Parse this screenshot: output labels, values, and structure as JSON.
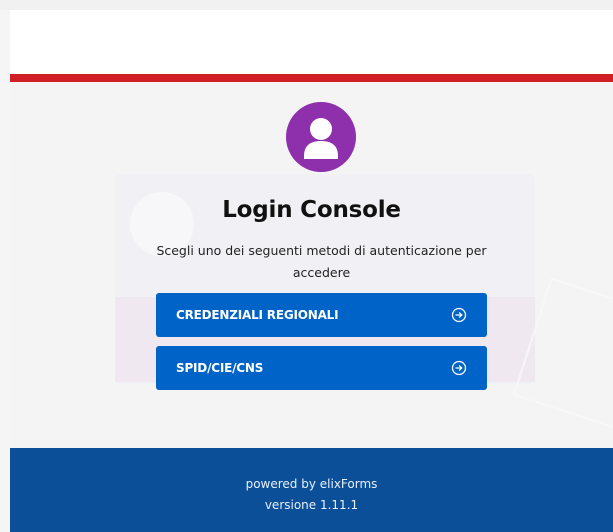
{
  "header": {
    "accent_color": "#d11f26"
  },
  "login": {
    "avatar_icon": "user-circle-icon",
    "avatar_color": "#8e2fac",
    "title": "Login Console",
    "subtitle": "Scegli uno dei seguenti metodi di autenticazione per accedere",
    "buttons": [
      {
        "label": "CREDENZIALI REGIONALI",
        "icon": "arrow-right-circle-icon"
      },
      {
        "label": "SPID/CIE/CNS",
        "icon": "arrow-right-circle-icon"
      }
    ],
    "button_color": "#0063c7"
  },
  "footer": {
    "powered_by": "powered by elixForms",
    "version": "versione 1.11.1",
    "background_color": "#0b4f99"
  }
}
